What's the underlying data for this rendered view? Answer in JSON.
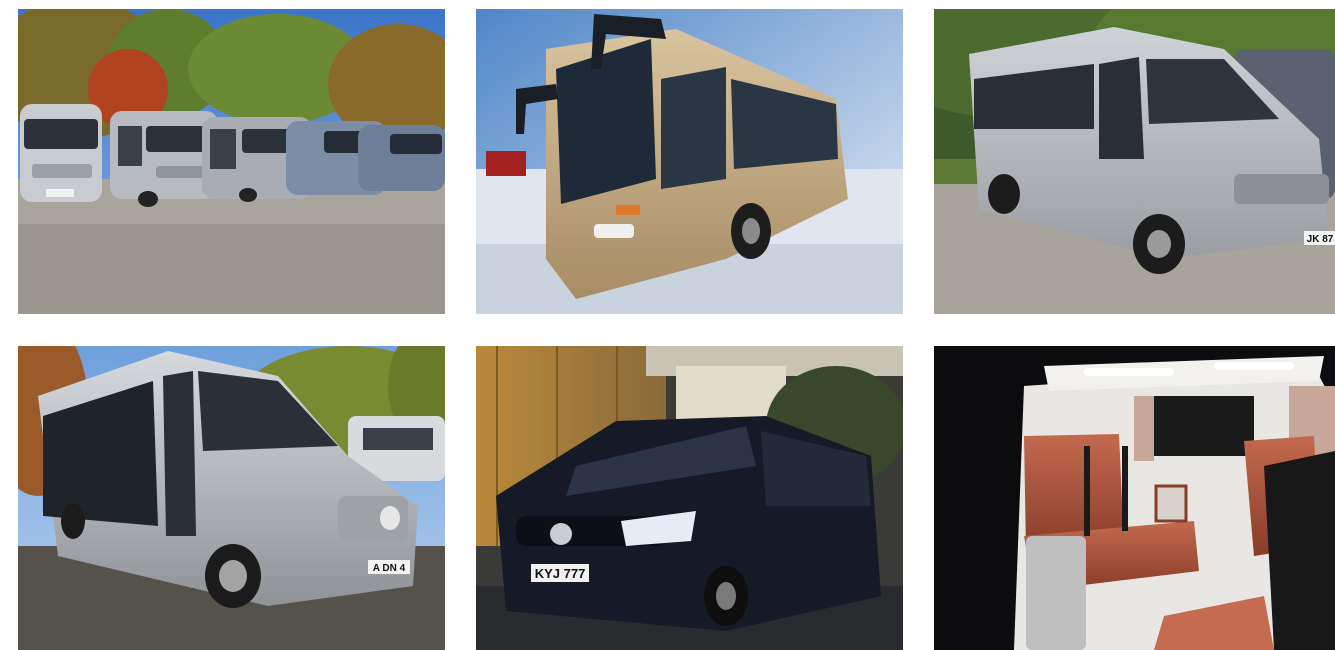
{
  "gallery": {
    "photos": [
      {
        "subject": "row of silver minibuses in parking lot",
        "plate": ""
      },
      {
        "subject": "gold coach bus in snow",
        "plate": ""
      },
      {
        "subject": "silver minibus side view",
        "plate": "JK 87"
      },
      {
        "subject": "silver minibus with trees",
        "plate": "A DN 4"
      },
      {
        "subject": "black minivan at night",
        "plate": "KYJ 777"
      },
      {
        "subject": "luxury van interior with leather seats",
        "plate": ""
      }
    ]
  },
  "colors": {
    "background": "#ffffff",
    "silver": "#b9bcc0",
    "gold": "#c9b08a",
    "black_van": "#151a26",
    "leather": "#b4583f"
  }
}
